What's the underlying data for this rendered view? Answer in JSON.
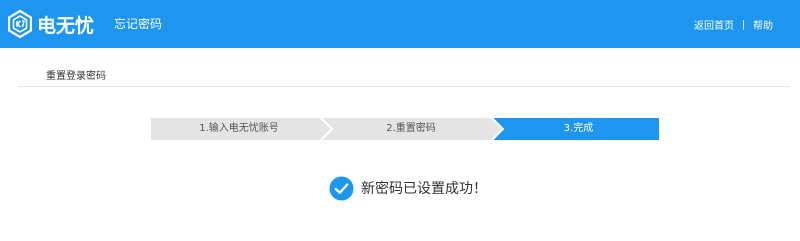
{
  "header": {
    "logo_text": "电无忧",
    "title": "忘记密码",
    "nav": {
      "home_label": "返回首页",
      "help_label": "帮助"
    }
  },
  "section": {
    "title": "重置登录密码"
  },
  "steps": [
    {
      "label": "1.输入电无忧账号",
      "state": "done"
    },
    {
      "label": "2.重置密码",
      "state": "done"
    },
    {
      "label": "3.完成",
      "state": "active"
    }
  ],
  "result": {
    "message": "新密码已设置成功！",
    "icon": "check-circle-icon"
  },
  "colors": {
    "brand": "#1e96ef",
    "step_inactive_bg": "#e4e4e4",
    "step_inactive_text": "#555555",
    "step_active_text": "#ffffff"
  }
}
